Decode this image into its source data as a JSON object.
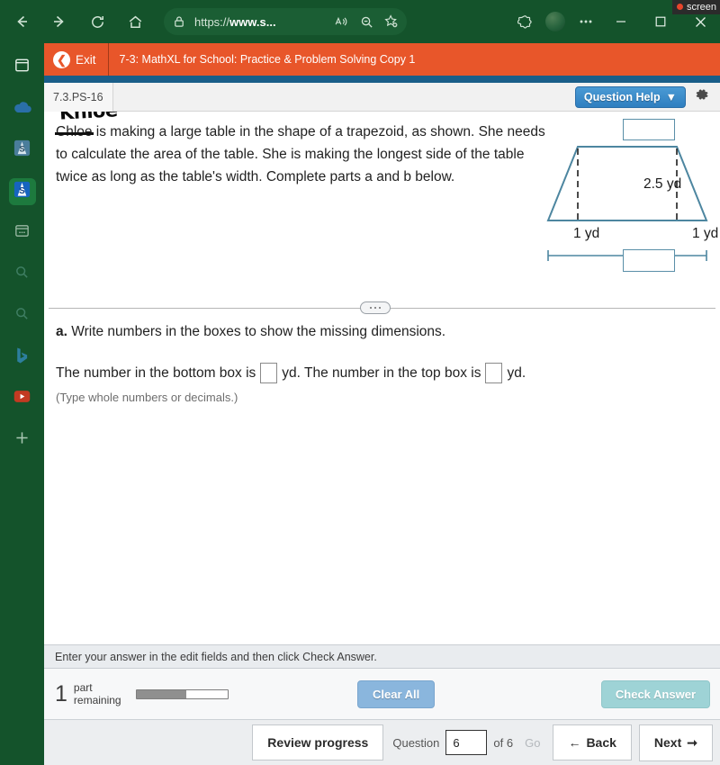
{
  "recording": {
    "label": "screen"
  },
  "browser": {
    "back_icon": "back-arrow-icon",
    "forward_icon": "forward-arrow-icon",
    "refresh_icon": "refresh-icon",
    "home_icon": "home-icon",
    "lock_icon": "lock-icon",
    "url": "https://www.s...",
    "url_bold": "www.s...",
    "url_prefix": "https://",
    "read_aloud_icon": "read-aloud-icon",
    "zoom_out_icon": "zoom-out-icon",
    "favorite_icon": "add-favorite-icon",
    "collections_icon": "collections-icon",
    "profile_icon": "profile-avatar-icon",
    "more_icon": "more-options-icon",
    "minimize_label": "–",
    "maximize_label": "□",
    "close_label": "✕"
  },
  "sidebar": {
    "items": [
      {
        "name": "copilot-pane-icon",
        "glyph": "window"
      },
      {
        "name": "onedrive-icon",
        "glyph": "cloud"
      },
      {
        "name": "app-s-icon",
        "glyph": "s-dim"
      },
      {
        "name": "app-s-active-icon",
        "glyph": "s-active"
      },
      {
        "name": "browser-essentials-icon",
        "glyph": "panel-dots"
      },
      {
        "name": "search-icon-1",
        "glyph": "search"
      },
      {
        "name": "search-icon-2",
        "glyph": "search"
      },
      {
        "name": "bing-icon",
        "glyph": "bing"
      },
      {
        "name": "video-icon",
        "glyph": "play"
      },
      {
        "name": "add-sidebar-app-icon",
        "glyph": "plus"
      }
    ]
  },
  "mathxl": {
    "exit_label": "Exit",
    "exit_icon": "back-circle-icon",
    "assignment_title": "7-3: MathXL for School: Practice & Problem Solving Copy 1",
    "question_id": "7.3.PS-16",
    "question_help_label": "Question Help",
    "question_help_caret": "▼",
    "settings_icon": "gear-icon"
  },
  "question": {
    "handwritten_note": "Khloe",
    "struck_name": "Chloe",
    "prompt_rest": " is making a large table in the shape of a trapezoid, as shown. She needs to calculate the area of the table. She is making the longest side of the table twice as long as the table's width. Complete parts a and b below.",
    "figure": {
      "height_label": "2.5 yd",
      "left_label": "1 yd",
      "right_label": "1 yd",
      "top_box_value": "",
      "bottom_box_value": "",
      "stroke_color": "#4d86a0"
    },
    "part_a_letter": "a.",
    "part_a_text": " Write numbers in the boxes to show the missing dimensions.",
    "fill_text_1": "The number in the bottom box is",
    "fill_unit_1": "yd. The number in the top box is",
    "fill_unit_2": "yd.",
    "bottom_box_answer": "",
    "top_box_answer": "",
    "type_note": "(Type whole numbers or decimals.)"
  },
  "footer": {
    "instruction": "Enter your answer in the edit fields and then click Check Answer.",
    "parts_count": "1",
    "parts_word_1": "part",
    "parts_word_2": "remaining",
    "progress_percent": 55,
    "clear_all_label": "Clear All",
    "check_answer_label": "Check Answer"
  },
  "nav": {
    "review_progress_label": "Review progress",
    "question_label": "Question",
    "question_number": "6",
    "of_label": "of 6",
    "go_label": "Go",
    "back_label": "Back",
    "back_icon": "left-arrow-icon",
    "next_label": "Next",
    "next_icon": "right-arrow-icon"
  },
  "colors": {
    "browser_green": "#14532b",
    "mathxl_orange": "#e8562a",
    "blue_strip": "#1a5e89",
    "help_blue": "#3b88c8",
    "figure_blue": "#4d86a0"
  }
}
